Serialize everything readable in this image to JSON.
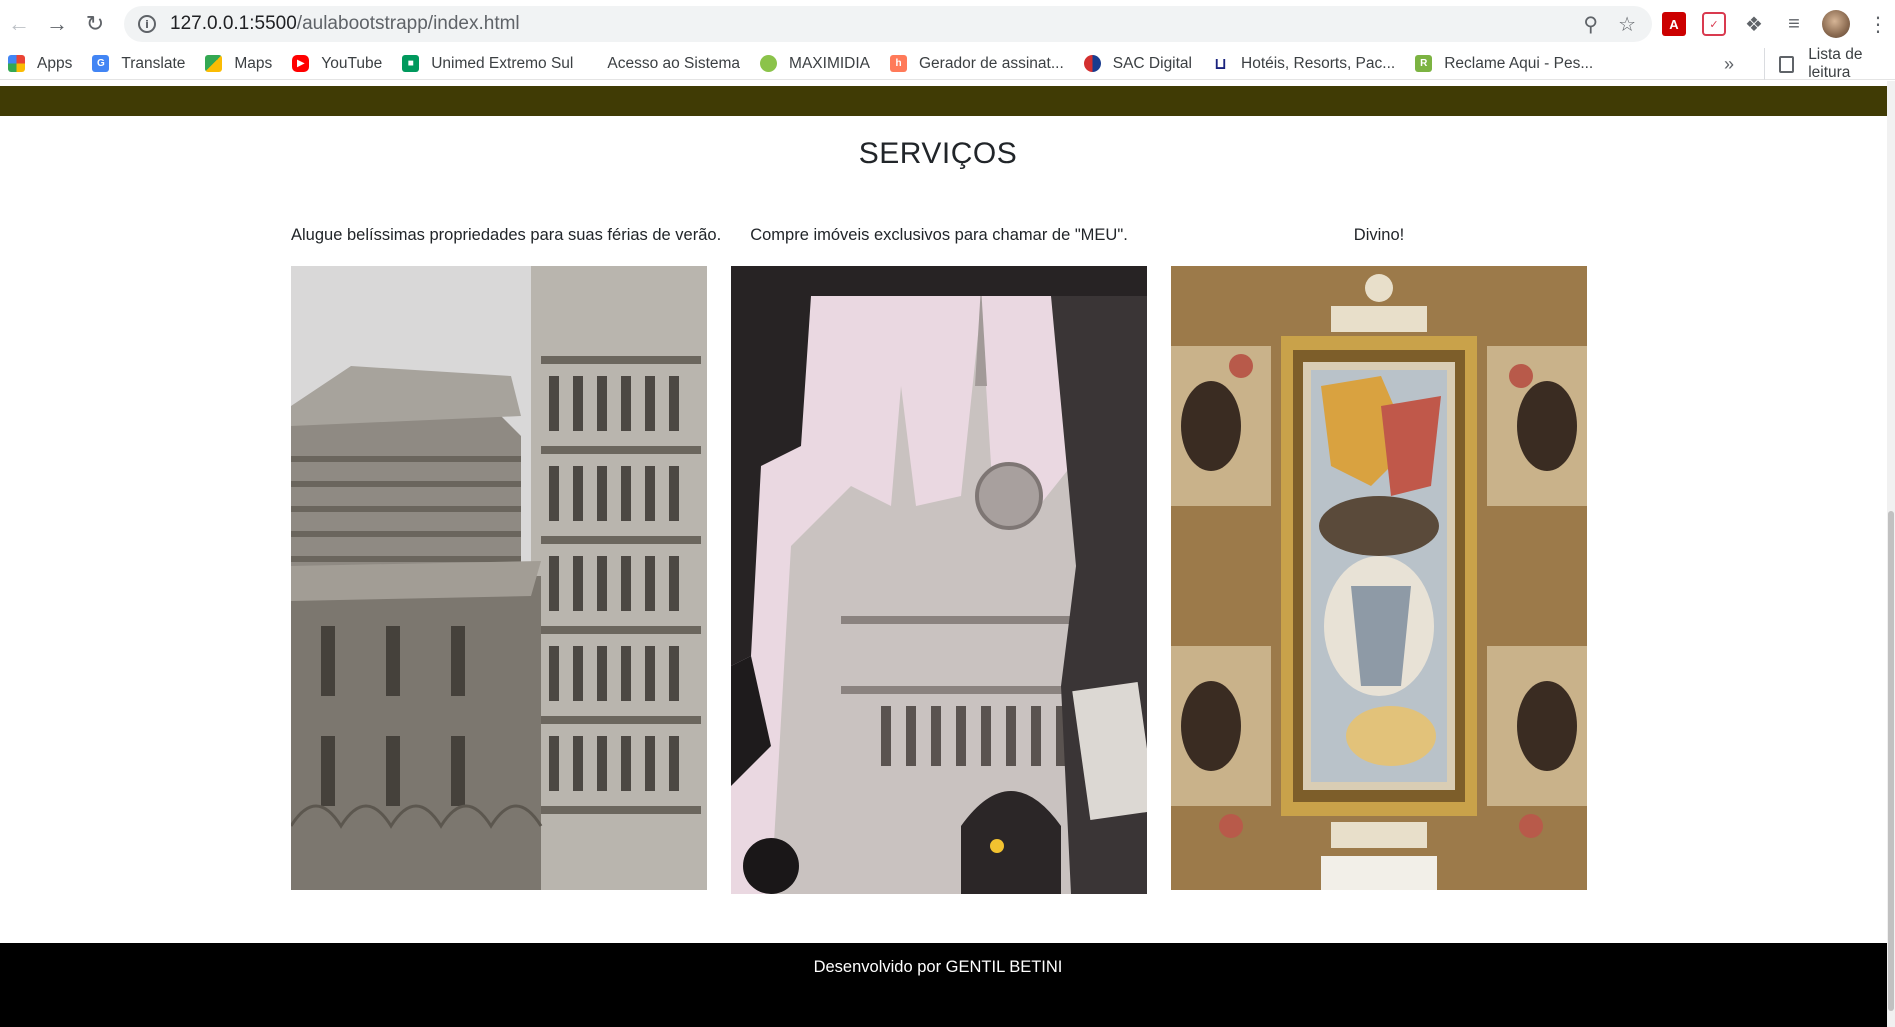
{
  "browser": {
    "url_host": "127.0.0.1:5500",
    "url_path": "/aulabootstrapp/index.html",
    "bookmarks": [
      {
        "label": "Apps",
        "icon": "apps-grid-icon",
        "color": "#4285f4"
      },
      {
        "label": "Translate",
        "icon": "google-translate-icon",
        "color": "#4285f4"
      },
      {
        "label": "Maps",
        "icon": "google-maps-icon",
        "color": "#34a853"
      },
      {
        "label": "YouTube",
        "icon": "youtube-icon",
        "color": "#ff0000"
      },
      {
        "label": "Unimed Extremo Sul",
        "icon": "unimed-icon",
        "color": "#00995d"
      },
      {
        "label": "Acesso ao Sistema",
        "icon": "blank-page-icon",
        "color": "#ffffff"
      },
      {
        "label": "MAXIMIDIA",
        "icon": "maximidia-icon",
        "color": "#8bc34a"
      },
      {
        "label": "Gerador de assinat...",
        "icon": "hubspot-icon",
        "color": "#ff7a59"
      },
      {
        "label": "SAC Digital",
        "icon": "sac-digital-icon",
        "color": "#1a3c8f"
      },
      {
        "label": "Hotéis, Resorts, Pac...",
        "icon": "hotel-icon",
        "color": "#1a237e"
      },
      {
        "label": "Reclame Aqui - Pes...",
        "icon": "reclame-aqui-icon",
        "color": "#7cb342"
      }
    ],
    "more_label": "»",
    "reading_list_label": "Lista de leitura"
  },
  "page": {
    "top_band_color": "#403b05",
    "section_title": "SERVIÇOS",
    "cards": [
      {
        "caption": "Alugue belíssimas propriedades para suas férias de verão.",
        "image": "pisa-cathedral-tower-photo"
      },
      {
        "caption": "Compre imóveis exclusivos para chamar de \"MEU\".",
        "image": "royal-courts-of-justice-photo"
      },
      {
        "caption": "Divino!",
        "image": "baroque-ceiling-fresco-photo"
      }
    ],
    "footer_text": "Desenvolvido por GENTIL BETINI"
  }
}
